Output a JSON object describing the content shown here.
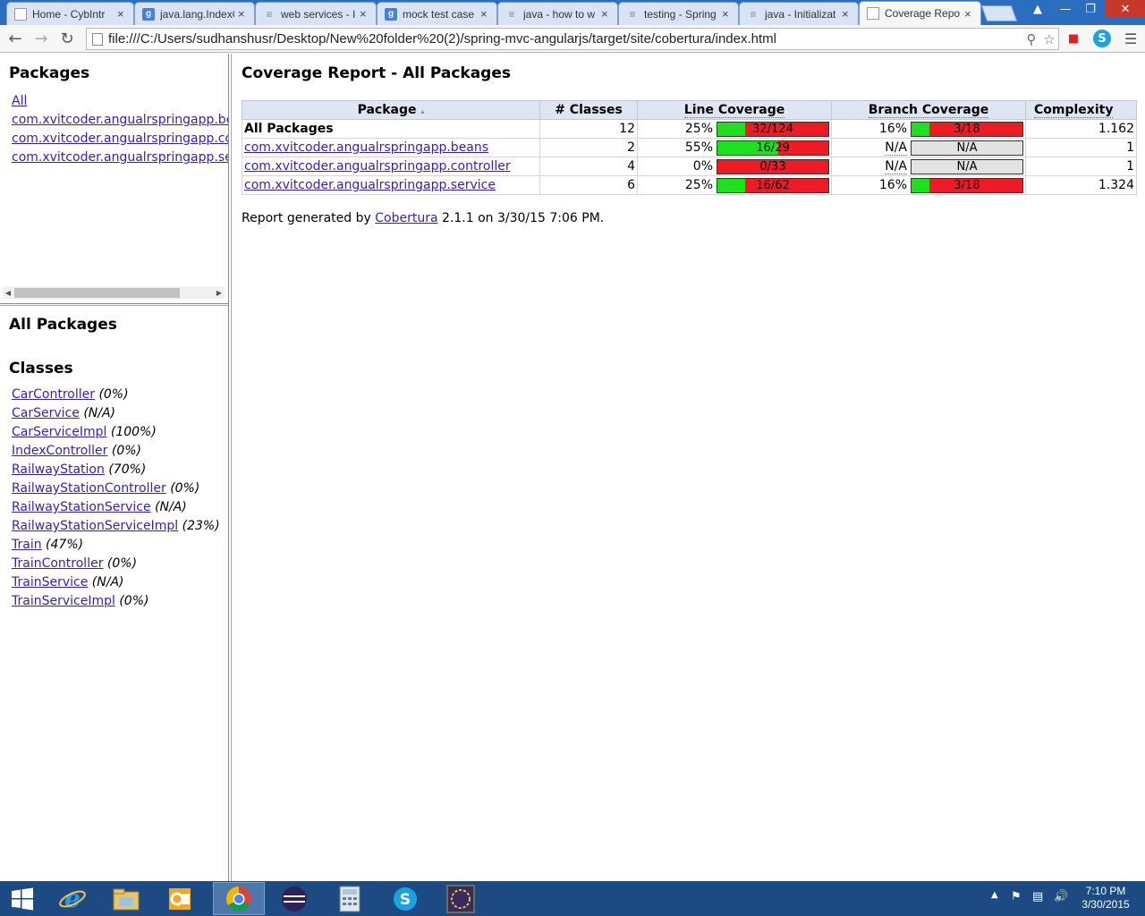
{
  "browser": {
    "tabs": [
      {
        "title": "Home - CybIntr",
        "icon": "document-icon"
      },
      {
        "title": "java.lang.IndexO",
        "icon": "google-icon"
      },
      {
        "title": "web services - I",
        "icon": "stackoverflow-icon"
      },
      {
        "title": "mock test case",
        "icon": "google-icon"
      },
      {
        "title": "java - how to w",
        "icon": "stackoverflow-icon"
      },
      {
        "title": "testing - Spring",
        "icon": "stackoverflow-icon"
      },
      {
        "title": "java - Initializat",
        "icon": "stackoverflow-icon"
      },
      {
        "title": "Coverage Repo",
        "icon": "document-icon",
        "active": true
      }
    ],
    "url": "file:///C:/Users/sudhanshusr/Desktop/New%20folder%20(2)/spring-mvc-angularjs/target/site/cobertura/index.html"
  },
  "packages_frame": {
    "title": "Packages",
    "links": [
      "All",
      "com.xvitcoder.angualrspringapp.beans",
      "com.xvitcoder.angualrspringapp.controller",
      "com.xvitcoder.angualrspringapp.service"
    ]
  },
  "classes_frame": {
    "title": "All Packages",
    "subtitle": "Classes",
    "classes": [
      {
        "name": "CarController",
        "pct": "(0%)"
      },
      {
        "name": "CarService",
        "pct": "(N/A)"
      },
      {
        "name": "CarServiceImpl",
        "pct": "(100%)"
      },
      {
        "name": "IndexController",
        "pct": "(0%)"
      },
      {
        "name": "RailwayStation",
        "pct": "(70%)"
      },
      {
        "name": "RailwayStationController",
        "pct": "(0%)"
      },
      {
        "name": "RailwayStationService",
        "pct": "(N/A)"
      },
      {
        "name": "RailwayStationServiceImpl",
        "pct": "(23%)"
      },
      {
        "name": "Train",
        "pct": "(47%)"
      },
      {
        "name": "TrainController",
        "pct": "(0%)"
      },
      {
        "name": "TrainService",
        "pct": "(N/A)"
      },
      {
        "name": "TrainServiceImpl",
        "pct": "(0%)"
      }
    ]
  },
  "report": {
    "title": "Coverage Report - All Packages",
    "headers": {
      "package": "Package",
      "classes": "# Classes",
      "line": "Line Coverage",
      "branch": "Branch Coverage",
      "complexity": "Complexity"
    },
    "rows": [
      {
        "package": "All Packages",
        "link": false,
        "classes": "12",
        "line_pct": "25%",
        "line_ratio": "32/124",
        "line_fill": 0.25,
        "branch_pct": "16%",
        "branch_ratio": "3/18",
        "branch_fill": 0.16,
        "complexity": "1.162"
      },
      {
        "package": "com.xvitcoder.angualrspringapp.beans",
        "link": true,
        "classes": "2",
        "line_pct": "55%",
        "line_ratio": "16/29",
        "line_fill": 0.55,
        "branch_pct": "N/A",
        "branch_ratio": "N/A",
        "branch_fill": null,
        "complexity": "1"
      },
      {
        "package": "com.xvitcoder.angualrspringapp.controller",
        "link": true,
        "classes": "4",
        "line_pct": "0%",
        "line_ratio": "0/33",
        "line_fill": 0,
        "branch_pct": "N/A",
        "branch_ratio": "N/A",
        "branch_fill": null,
        "complexity": "1"
      },
      {
        "package": "com.xvitcoder.angualrspringapp.service",
        "link": true,
        "classes": "6",
        "line_pct": "25%",
        "line_ratio": "16/62",
        "line_fill": 0.25,
        "branch_pct": "16%",
        "branch_ratio": "3/18",
        "branch_fill": 0.16,
        "complexity": "1.324"
      }
    ],
    "footer_prefix": "Report generated by ",
    "footer_link": "Cobertura",
    "footer_suffix": " 2.1.1 on 3/30/15 7:06 PM."
  },
  "taskbar": {
    "apps": [
      "windows-start-icon",
      "internet-explorer-icon",
      "file-explorer-icon",
      "outlook-icon",
      "chrome-icon",
      "eclipse-icon",
      "calculator-icon",
      "skype-icon",
      "java-ee-ide-icon"
    ],
    "time": "7:10 PM",
    "date": "3/30/2015"
  },
  "colors": {
    "covered": "#1fe01f",
    "uncovered": "#ed1c24",
    "not_applicable": "#e2e2e2",
    "header_bg": "#dee6f4",
    "link": "#3b1ea5",
    "taskbar": "#1d4a82",
    "tabstrip": "#2b6ec0"
  }
}
